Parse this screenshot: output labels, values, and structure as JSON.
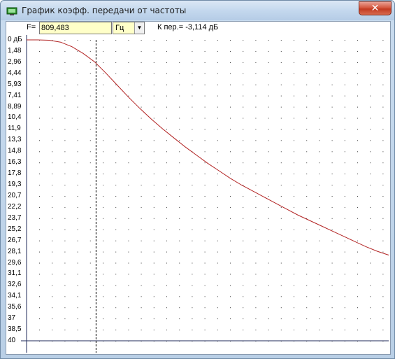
{
  "window": {
    "title": "График коэфф. передачи от частоты",
    "close_glyph": "✕"
  },
  "toolbar": {
    "f_label": "F=",
    "frequency_value": "809,483",
    "unit_selected": "Гц",
    "k_readout": "К пер.= -3,114 дБ"
  },
  "colors": {
    "curve": "#b22222",
    "grid_dots": "#3a3a3a",
    "axis": "#1f2a5a",
    "input_bg": "#ffffc8"
  },
  "chart_data": {
    "type": "line",
    "title": "",
    "xlabel": "",
    "ylabel": "",
    "y_tick_labels": [
      "0 дБ",
      "1,48",
      "2,96",
      "4,44",
      "5,93",
      "7,41",
      "8,89",
      "10,4",
      "11,9",
      "13,3",
      "14,8",
      "16,3",
      "17,8",
      "19,3",
      "20,7",
      "22,2",
      "23,7",
      "25,2",
      "26,7",
      "28,1",
      "29,6",
      "31,1",
      "32,6",
      "34,1",
      "35,6",
      "37",
      "38,5",
      "40"
    ],
    "ylim": [
      0,
      40
    ],
    "y_inverted": true,
    "grid": "dotted",
    "cursor_db": 3.114,
    "series": [
      {
        "points_db": [
          0,
          0,
          0.05,
          0.3,
          0.9,
          1.8,
          2.9,
          4.4,
          6.0,
          7.6,
          9.1,
          10.5,
          11.8,
          13.0,
          14.2,
          15.3,
          16.4,
          17.4,
          18.4,
          19.3,
          20.1,
          20.9,
          21.7,
          22.5,
          23.3,
          24.0,
          24.7,
          25.4,
          26.1,
          26.8,
          27.5,
          28.1,
          28.6
        ]
      }
    ]
  }
}
